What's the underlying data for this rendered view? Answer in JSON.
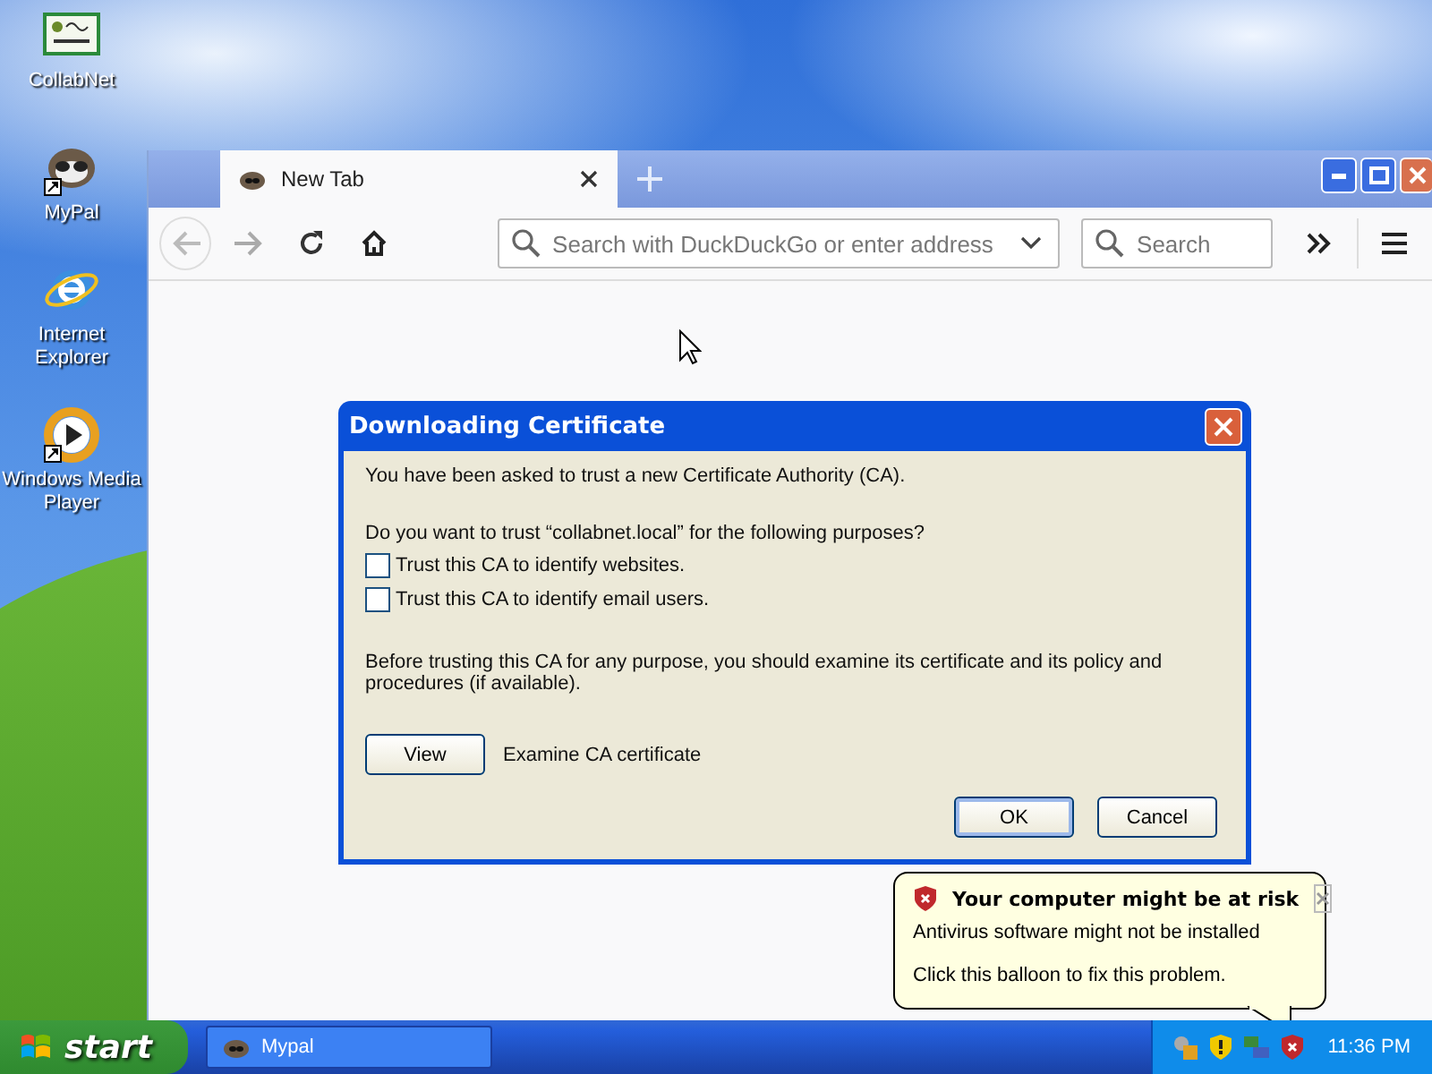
{
  "desktop_icons": [
    {
      "label": "CollabNet",
      "kind": "certificate"
    },
    {
      "label": "MyPal",
      "kind": "raccoon"
    },
    {
      "label": "Internet Explorer",
      "kind": "ie"
    },
    {
      "label": "Windows Media Player",
      "kind": "media"
    }
  ],
  "browser": {
    "tabs": [
      {
        "label": "New Tab",
        "selected": true
      }
    ],
    "address": {
      "placeholder": "Search with DuckDuckGo or enter address"
    },
    "search": {
      "placeholder": "Search"
    }
  },
  "dialog": {
    "title": "Downloading Certificate",
    "intro": "You have been asked to trust a new Certificate Authority (CA).",
    "question": "Do you want to trust “collabnet.local” for the following purposes?",
    "options": [
      {
        "label": "Trust this CA to identify websites.",
        "checked": false
      },
      {
        "label": "Trust this CA to identify email users.",
        "checked": false
      }
    ],
    "advice": "Before trusting this CA for any purpose, you should examine its certificate and its policy and procedures (if available).",
    "view_button": "View",
    "view_label": "Examine CA certificate",
    "buttons": [
      "OK",
      "Cancel"
    ]
  },
  "balloon": {
    "title": "Your computer might be at risk",
    "lines": [
      "Antivirus software might not be installed",
      "Click this balloon to fix this problem."
    ]
  },
  "taskbar": {
    "start": "start",
    "tasks": [
      {
        "label": "Mypal",
        "selected": false
      }
    ],
    "clock": "11:36 PM"
  }
}
